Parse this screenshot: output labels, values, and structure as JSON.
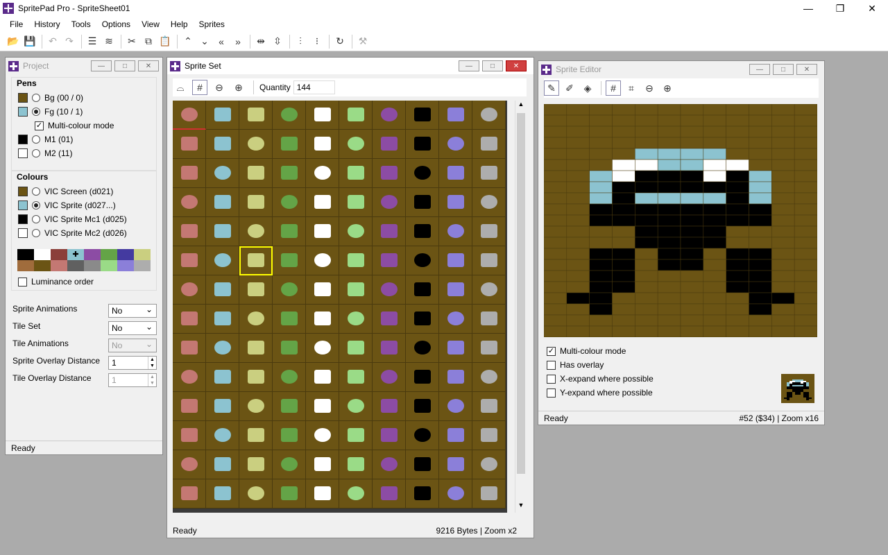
{
  "app": {
    "title": "SpritePad Pro - SpriteSheet01",
    "min": "—",
    "max": "❐",
    "close": "✕"
  },
  "menu": [
    "File",
    "History",
    "Tools",
    "Options",
    "View",
    "Help",
    "Sprites"
  ],
  "project": {
    "title": "Project",
    "pens_title": "Pens",
    "pens": [
      {
        "label": "Bg (00 / 0)",
        "color": "#6b5414",
        "selected": false
      },
      {
        "label": "Fg (10 / 1)",
        "color": "#8cc3d0",
        "selected": true
      },
      {
        "label": "M1 (01)",
        "color": "#000000",
        "selected": false
      },
      {
        "label": "M2 (11)",
        "color": "#ffffff",
        "selected": false
      }
    ],
    "multicolour": "Multi-colour mode",
    "colours_title": "Colours",
    "colours": [
      {
        "label": "VIC Screen (d021)",
        "color": "#6b5414",
        "selected": false
      },
      {
        "label": "VIC Sprite (d027...)",
        "color": "#8cc3d0",
        "selected": true
      },
      {
        "label": "VIC Sprite Mc1 (d025)",
        "color": "#000000",
        "selected": false
      },
      {
        "label": "VIC Sprite Mc2 (d026)",
        "color": "#ffffff",
        "selected": false
      }
    ],
    "palette": [
      "#000000",
      "#ffffff",
      "#8b3f3a",
      "#8cc3d0",
      "#8c4ca4",
      "#64a447",
      "#443aa0",
      "#cacf80",
      "#a06c3c",
      "#6b5414",
      "#c47873",
      "#606060",
      "#8a8a8a",
      "#9adb87",
      "#8b7fd9",
      "#adadad"
    ],
    "luminance": "Luminance order",
    "sprite_anim_label": "Sprite Animations",
    "sprite_anim_value": "No",
    "tile_set_label": "Tile Set",
    "tile_set_value": "No",
    "tile_anim_label": "Tile Animations",
    "tile_anim_value": "No",
    "sprite_overlay_label": "Sprite Overlay Distance",
    "sprite_overlay_value": "1",
    "tile_overlay_label": "Tile Overlay Distance",
    "tile_overlay_value": "1",
    "status": "Ready"
  },
  "spriteset": {
    "title": "Sprite Set",
    "quantity_label": "Quantity",
    "quantity_value": "144",
    "status_left": "Ready",
    "status_right": "9216 Bytes | Zoom x2"
  },
  "editor": {
    "title": "Sprite Editor",
    "options": [
      {
        "label": "Multi-colour mode",
        "checked": true
      },
      {
        "label": "Has overlay",
        "checked": false
      },
      {
        "label": "X-expand where possible",
        "checked": false
      },
      {
        "label": "Y-expand where possible",
        "checked": false
      }
    ],
    "status_left": "Ready",
    "status_right": "#52 ($34) | Zoom x16"
  }
}
